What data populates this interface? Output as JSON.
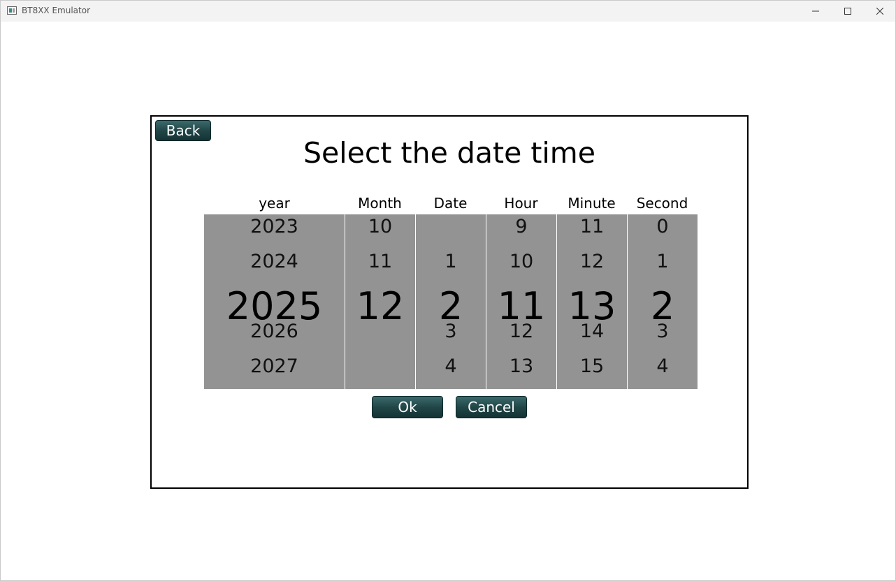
{
  "window": {
    "title": "BT8XX Emulator",
    "controls": {
      "minimize": "minimize-icon",
      "maximize": "maximize-icon",
      "close": "close-icon"
    }
  },
  "dialog": {
    "back_label": "Back",
    "heading": "Select the date time",
    "ok_label": "Ok",
    "cancel_label": "Cancel",
    "button_color": "#214647",
    "wheel_color": "#939393"
  },
  "columns": [
    {
      "label": "year",
      "items": [
        "2023",
        "2024",
        "2025",
        "2026",
        "2027"
      ],
      "selected": "2025"
    },
    {
      "label": "Month",
      "items": [
        "10",
        "11",
        "12",
        "",
        ""
      ],
      "selected": "12"
    },
    {
      "label": "Date",
      "items": [
        "",
        "1",
        "2",
        "3",
        "4"
      ],
      "selected": "2"
    },
    {
      "label": "Hour",
      "items": [
        "9",
        "10",
        "11",
        "12",
        "13"
      ],
      "selected": "11"
    },
    {
      "label": "Minute",
      "items": [
        "11",
        "12",
        "13",
        "14",
        "15"
      ],
      "selected": "13"
    },
    {
      "label": "Second",
      "items": [
        "0",
        "1",
        "2",
        "3",
        "4"
      ],
      "selected": "2"
    }
  ]
}
